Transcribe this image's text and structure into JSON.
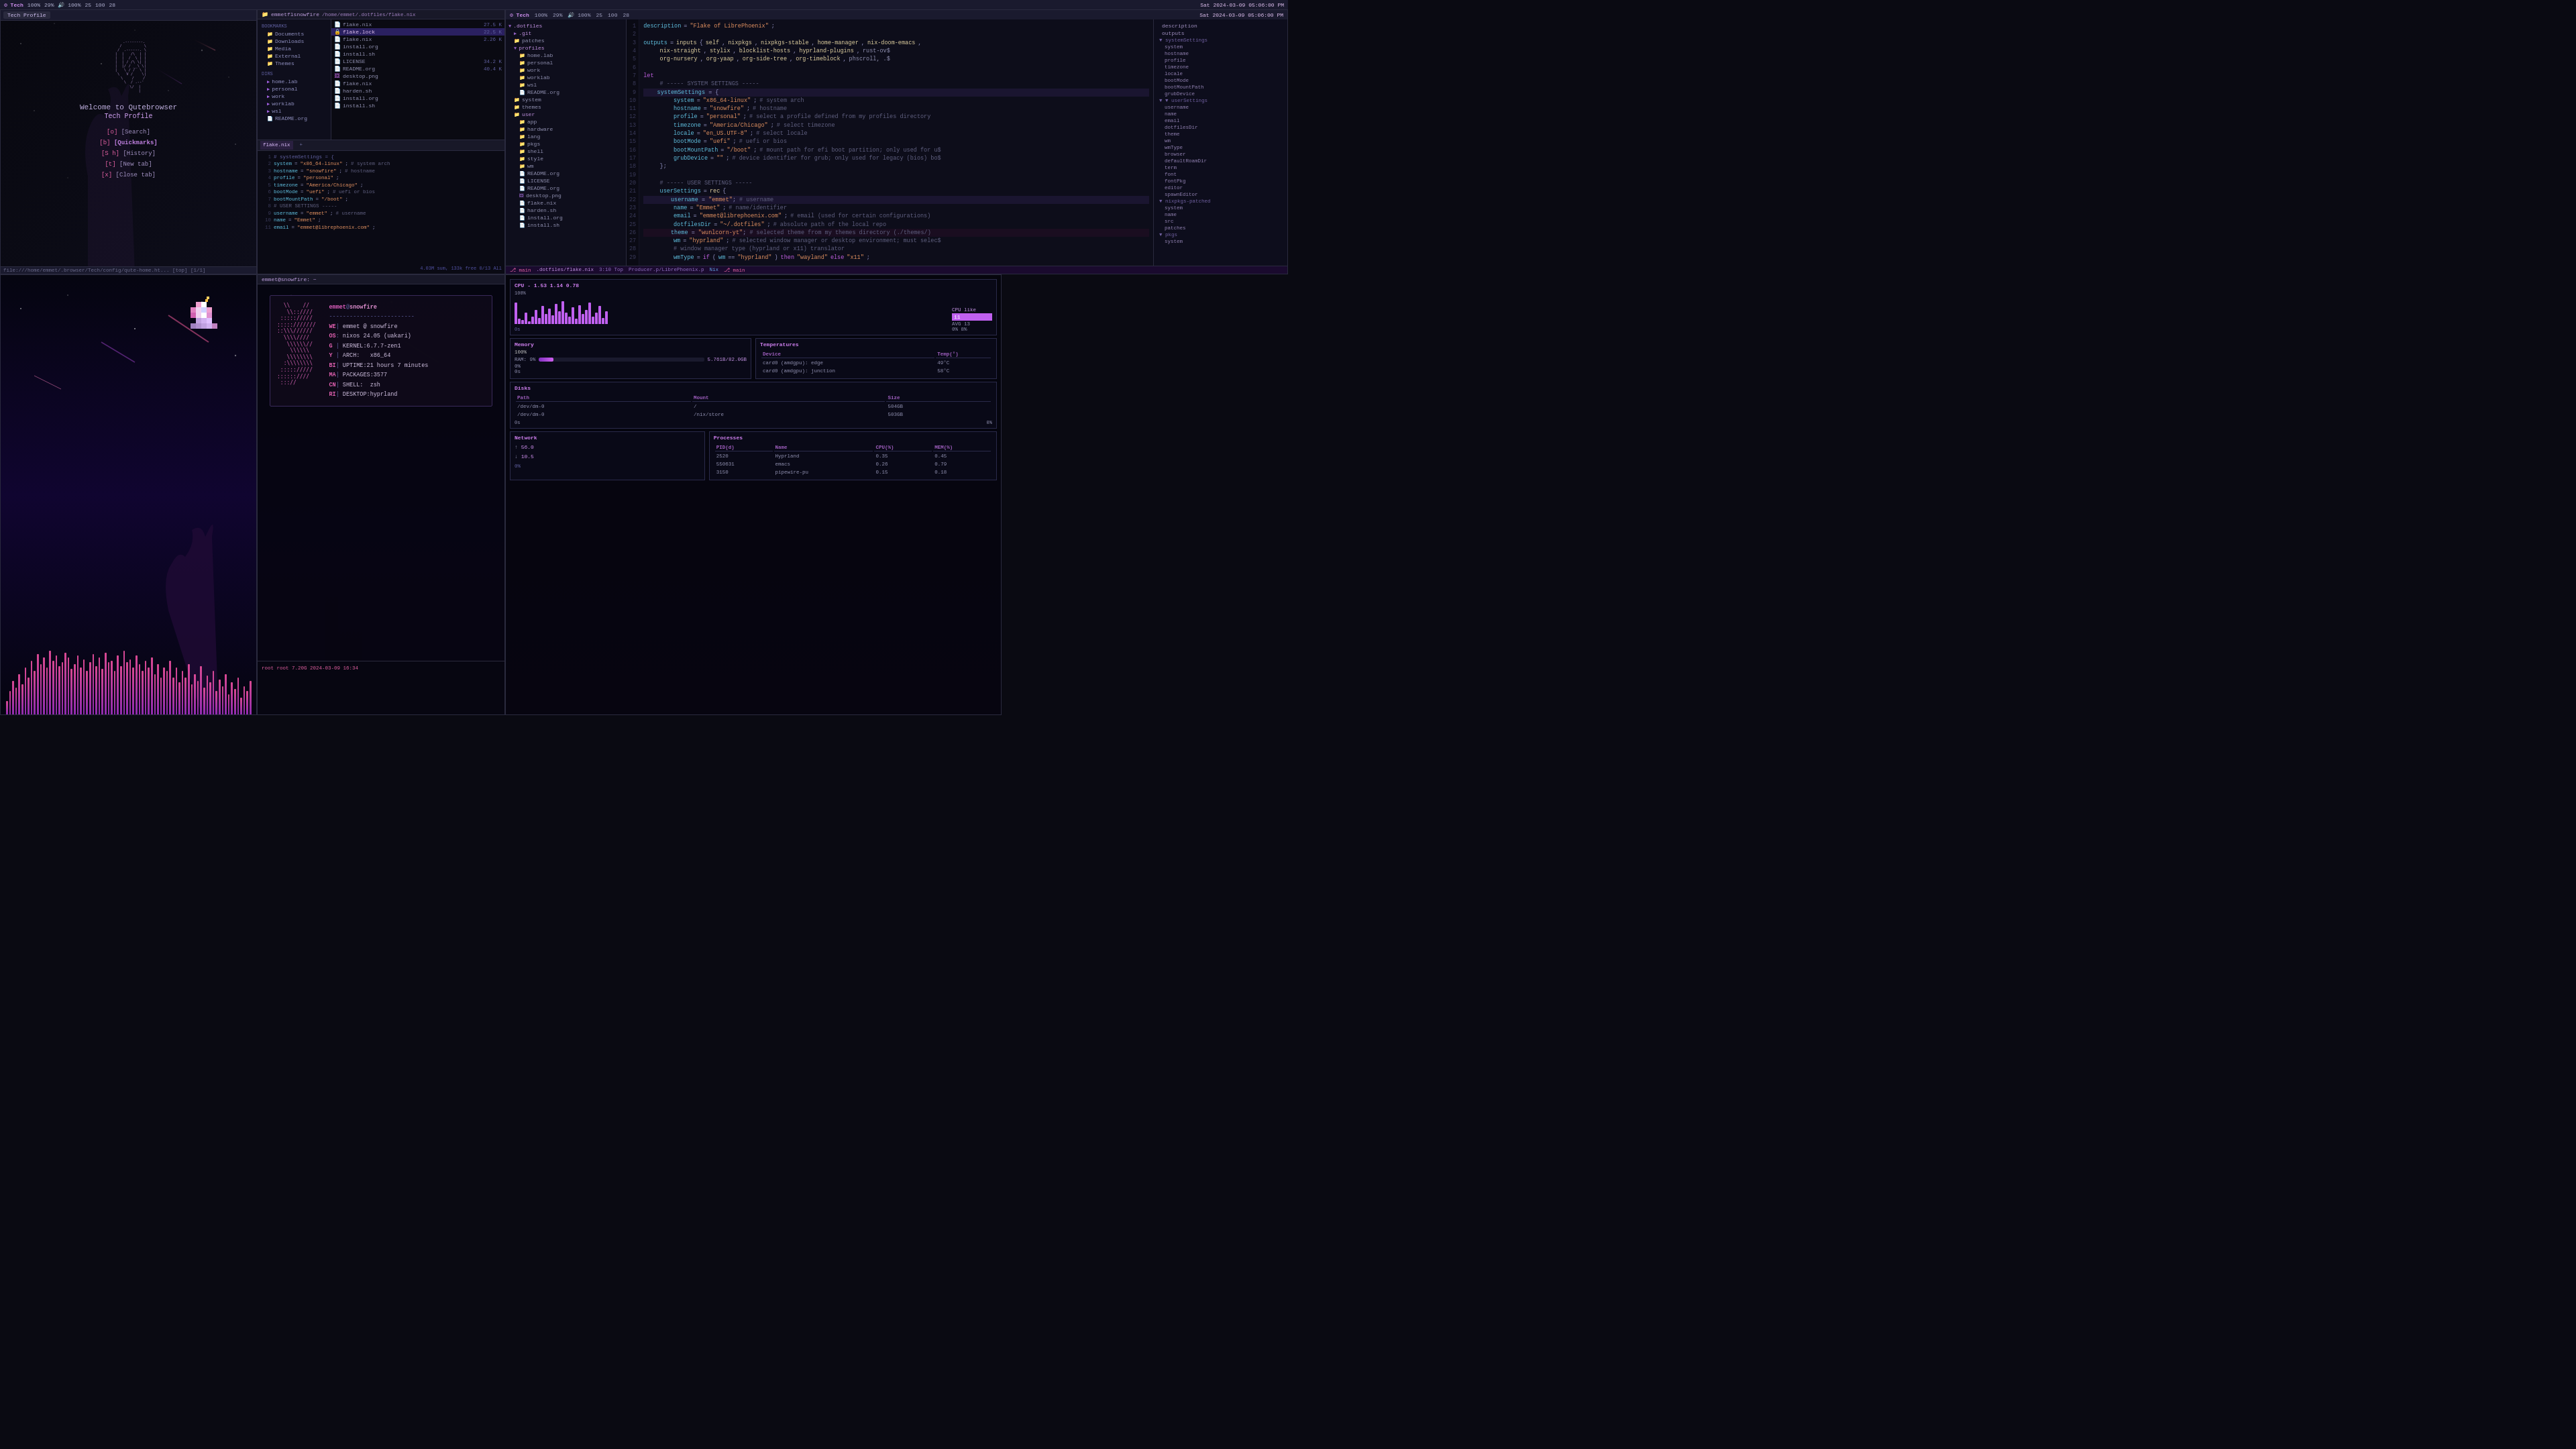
{
  "statusbar": {
    "brand": "Tech",
    "cpu": "100%",
    "ram": "29%",
    "ssd": "100%",
    "brightness": "25",
    "vol": "100",
    "bar": "28",
    "datetime": "Sat 2024-03-09 05:06:00 PM"
  },
  "qutebrowser": {
    "tab": "Tech Profile",
    "welcome": "Welcome to Qutebrowser",
    "profile": "Tech Profile",
    "links": [
      {
        "key": "[o]",
        "text": "[Search]"
      },
      {
        "key": "[b]",
        "text": "[Quickmarks]",
        "bold": true
      },
      {
        "key": "[S h]",
        "text": "[History]"
      },
      {
        "key": "[t]",
        "text": "[New tab]"
      },
      {
        "key": "[x]",
        "text": "[Close tab]"
      }
    ],
    "statusbar": "file:///home/emmet/.browser/Tech/config/qute-home.ht... [top] [1/1]",
    "ascii_logo": "     .......   \n   ..       ..  \n  .   .....  .  \n .   .     .  . \n.   .   D  .   .\n.   .     .   .\n .   .....  . .\n  .         . \n   ..       .  \n     .......   "
  },
  "filemanager": {
    "titlebar": "emmetflsnowfire",
    "path": "/home/emmet/.dotfiles/flake.nix",
    "sidebar": {
      "bookmarks": [
        "Documents",
        "Downloads",
        "Media",
        "External",
        "Themes"
      ],
      "dirs": [
        "home.lab",
        "personal",
        "work",
        "worklab",
        "wsl",
        "README.org"
      ]
    },
    "files": [
      {
        "name": "flake.nix",
        "size": "27.5 K",
        "selected": true
      },
      {
        "name": "flake.lock",
        "size": "22.5 K"
      },
      {
        "name": "install.org",
        "size": ""
      },
      {
        "name": "install.sh",
        "size": ""
      },
      {
        "name": "LICENSE",
        "size": "34.2 K"
      },
      {
        "name": "README.org",
        "size": "40.4 K"
      }
    ],
    "tree": {
      "root": ".dotfiles",
      "dirs": [
        ".git",
        "patches",
        "profiles",
        "system",
        "themes",
        "user"
      ]
    }
  },
  "code": {
    "filename": "flake.nix",
    "language": "Nix",
    "lines": [
      {
        "n": 1,
        "text": "description = \"Flake of LibrePhoenix\";"
      },
      {
        "n": 2,
        "text": ""
      },
      {
        "n": 3,
        "text": "outputs = inputs{ self, nixpkgs, nixpkgs-stable, home-manager, nix-doom-emacs,"
      },
      {
        "n": 4,
        "text": "    nix-straight, stylix, blocklist-hosts, hyprland-plugins, rust-ov$"
      },
      {
        "n": 5,
        "text": "    org-nursery, org-yaap, org-side-tree, org-timeblock, phscroll, .$"
      },
      {
        "n": 6,
        "text": ""
      },
      {
        "n": 7,
        "text": "let"
      },
      {
        "n": 8,
        "text": "    # ----- SYSTEM SETTINGS -----"
      },
      {
        "n": 9,
        "text": "    systemSettings = {"
      },
      {
        "n": 10,
        "text": "        system = \"x86_64-linux\"; # system arch"
      },
      {
        "n": 11,
        "text": "        hostname = \"snowfire\"; # hostname"
      },
      {
        "n": 12,
        "text": "        profile = \"personal\"; # select a profile defined from my profiles directory"
      },
      {
        "n": 13,
        "text": "        timezone = \"America/Chicago\"; # select timezone"
      },
      {
        "n": 14,
        "text": "        locale = \"en_US.UTF-8\"; # select locale"
      },
      {
        "n": 15,
        "text": "        bootMode = \"uefi\"; # uefi or bios"
      },
      {
        "n": 16,
        "text": "        bootMountPath = \"/boot\"; # mount path for efi boot partition; only used for u$"
      },
      {
        "n": 17,
        "text": "        grubDevice = \"\"; # device identifier for grub; only used for legacy (bios) bo$"
      },
      {
        "n": 18,
        "text": "    };"
      },
      {
        "n": 19,
        "text": ""
      },
      {
        "n": 20,
        "text": "    # ----- USER SETTINGS -----"
      },
      {
        "n": 21,
        "text": "    userSettings = rec {"
      },
      {
        "n": 22,
        "text": "        username = \"emmet\"; # username"
      },
      {
        "n": 23,
        "text": "        name = \"Emmet\"; # name/identifier"
      },
      {
        "n": 24,
        "text": "        email = \"emmet@librephoenix.com\"; # email (used for certain configurations)"
      },
      {
        "n": 25,
        "text": "        dotfilesDir = \"~/.dotfiles\"; # absolute path of the local repo"
      },
      {
        "n": 26,
        "text": "        theme = \"wunlcorn-yt\"; # selected theme from my themes directory (./themes/)"
      },
      {
        "n": 27,
        "text": "        wm = \"hyprland\"; # selected window manager or desktop environment; must selec$"
      },
      {
        "n": 28,
        "text": "        # window manager type (hyprland or x11) translator"
      },
      {
        "n": 29,
        "text": "        wmType = if (wm == \"hyprland\") then \"wayland\" else \"x11\";"
      }
    ],
    "right_panel": {
      "description": [
        "description"
      ],
      "outputs": [
        "outputs"
      ],
      "systemSettings": {
        "children": [
          "system",
          "hostname",
          "profile",
          "timezone",
          "locale",
          "bootMode",
          "bootMountPath",
          "grubDevice"
        ]
      },
      "userSettings": {
        "children": [
          "username",
          "name",
          "email",
          "dotfilesDir",
          "theme",
          "wm",
          "wmType",
          "browser",
          "defaultRoamDir",
          "term",
          "font",
          "fontPkg",
          "editor",
          "spawnEditor"
        ]
      },
      "nixpkgs_patched": {
        "children": [
          "system",
          "name",
          "src",
          "patches"
        ]
      },
      "pkgs": {
        "children": [
          "system"
        ]
      }
    }
  },
  "neofetch": {
    "user": "emmet",
    "host": "snowfire",
    "os": "nixos 24.05 (uakari)",
    "kernel": "6.7.7-zen1",
    "arch": "x86_64",
    "uptime": "21 hours 7 minutes",
    "packages": "3577",
    "shell": "zsh",
    "desktop": "hyprland",
    "separator": "@",
    "labels": {
      "we": "WE",
      "os": "OS",
      "ke": "KERNEL",
      "ar": "ARCH",
      "up": "UPTIME",
      "pk": "PACKAGES",
      "sh": "SHELL",
      "de": "DESKTOP"
    }
  },
  "sysmon": {
    "cpu": {
      "title": "CPU - 1.53 1.14 0.78",
      "bars": [
        85,
        20,
        15,
        45,
        10,
        30,
        55,
        25,
        70,
        40,
        60,
        35,
        80,
        50,
        90,
        45,
        30,
        65,
        20,
        75,
        40,
        55,
        85,
        30,
        45,
        70,
        25,
        50
      ],
      "avg": 13,
      "current": 8,
      "label100": "100%"
    },
    "memory": {
      "title": "Memory",
      "ram_label": "RAM: 9%",
      "ram_val": "5.761B/82.0GB",
      "swap_val": "0%",
      "bar_pct": 9
    },
    "temperatures": {
      "title": "Temperatures",
      "items": [
        {
          "device": "card0 (amdgpu): edge",
          "temp": "49°C"
        },
        {
          "device": "card0 (amdgpu): junction",
          "temp": "58°C"
        }
      ]
    },
    "disks": {
      "title": "Disks",
      "items": [
        {
          "path": "/dev/dm-0",
          "mount": "/",
          "size": "504GB"
        },
        {
          "path": "/dev/dm-0",
          "mount": "/nix/store",
          "size": "503GB"
        }
      ]
    },
    "network": {
      "title": "Network",
      "up": "56.0",
      "down": "10.5",
      "unit": "0%"
    },
    "processes": {
      "title": "Processes",
      "items": [
        {
          "pid": 2520,
          "name": "Hyprland",
          "cpu": "0.35",
          "mem": "0.45"
        },
        {
          "pid": 550631,
          "name": "emacs",
          "cpu": "0.26",
          "mem": "0.79"
        },
        {
          "pid": 3150,
          "name": "pipewire-pu",
          "cpu": "0.15",
          "mem": "0.18"
        }
      ]
    }
  },
  "visualizer": {
    "bars": [
      20,
      35,
      50,
      40,
      60,
      45,
      70,
      55,
      80,
      65,
      90,
      75,
      85,
      70,
      95,
      80,
      88,
      72,
      78,
      92,
      85,
      68,
      75,
      88,
      70,
      82,
      65,
      78,
      90,
      72,
      85,
      68,
      92,
      78,
      80,
      65,
      88,
      72,
      95,
      78,
      82,
      70,
      88,
      75,
      65,
      80,
      70,
      85,
      60,
      75,
      55,
      70,
      65,
      80,
      55,
      70,
      48,
      65,
      55,
      75,
      45,
      60,
      50,
      72,
      40,
      58,
      48,
      65,
      35,
      52,
      42,
      60,
      30,
      48,
      38,
      55,
      25,
      42,
      35,
      50
    ]
  }
}
